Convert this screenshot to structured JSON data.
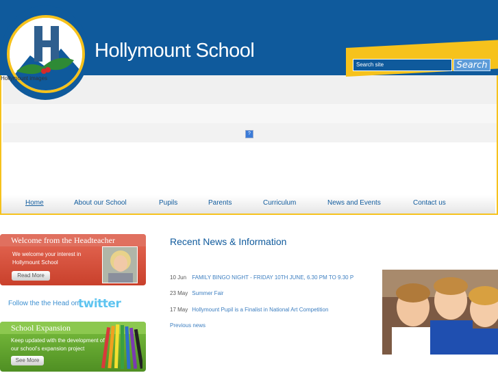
{
  "header": {
    "school_name": "Hollymount School",
    "logo_alt": "Hollymount images"
  },
  "search": {
    "placeholder": "Search site",
    "button_label": "Search"
  },
  "nav": {
    "items": [
      {
        "label": "Home"
      },
      {
        "label": "About our School"
      },
      {
        "label": "Pupils"
      },
      {
        "label": "Parents"
      },
      {
        "label": "Curriculum"
      },
      {
        "label": "News and Events"
      },
      {
        "label": "Contact us"
      }
    ]
  },
  "welcome": {
    "title": "Welcome from the Headteacher",
    "text": "We welcome your interest in Hollymount School",
    "button": "Read More"
  },
  "twitter": {
    "text": "Follow the the Head on",
    "logo": "twitter"
  },
  "expansion": {
    "title": "School Expansion",
    "text": "Keep updated with the development of our school's expansion project",
    "button": "See More"
  },
  "news": {
    "title": "Recent News & Information",
    "items": [
      {
        "date": "10 Jun",
        "text": "FAMILY BINGO NIGHT - FRIDAY 10TH JUNE, 6.30 PM TO 9.30 P"
      },
      {
        "date": "23 May",
        "text": "Summer Fair"
      },
      {
        "date": "17 May",
        "text": "Hollymount Pupil is a Finalist in National Art Competition"
      }
    ],
    "previous": "Previous news"
  },
  "colors": {
    "brand_blue": "#0f5a9c",
    "accent_yellow": "#f6c21c"
  }
}
